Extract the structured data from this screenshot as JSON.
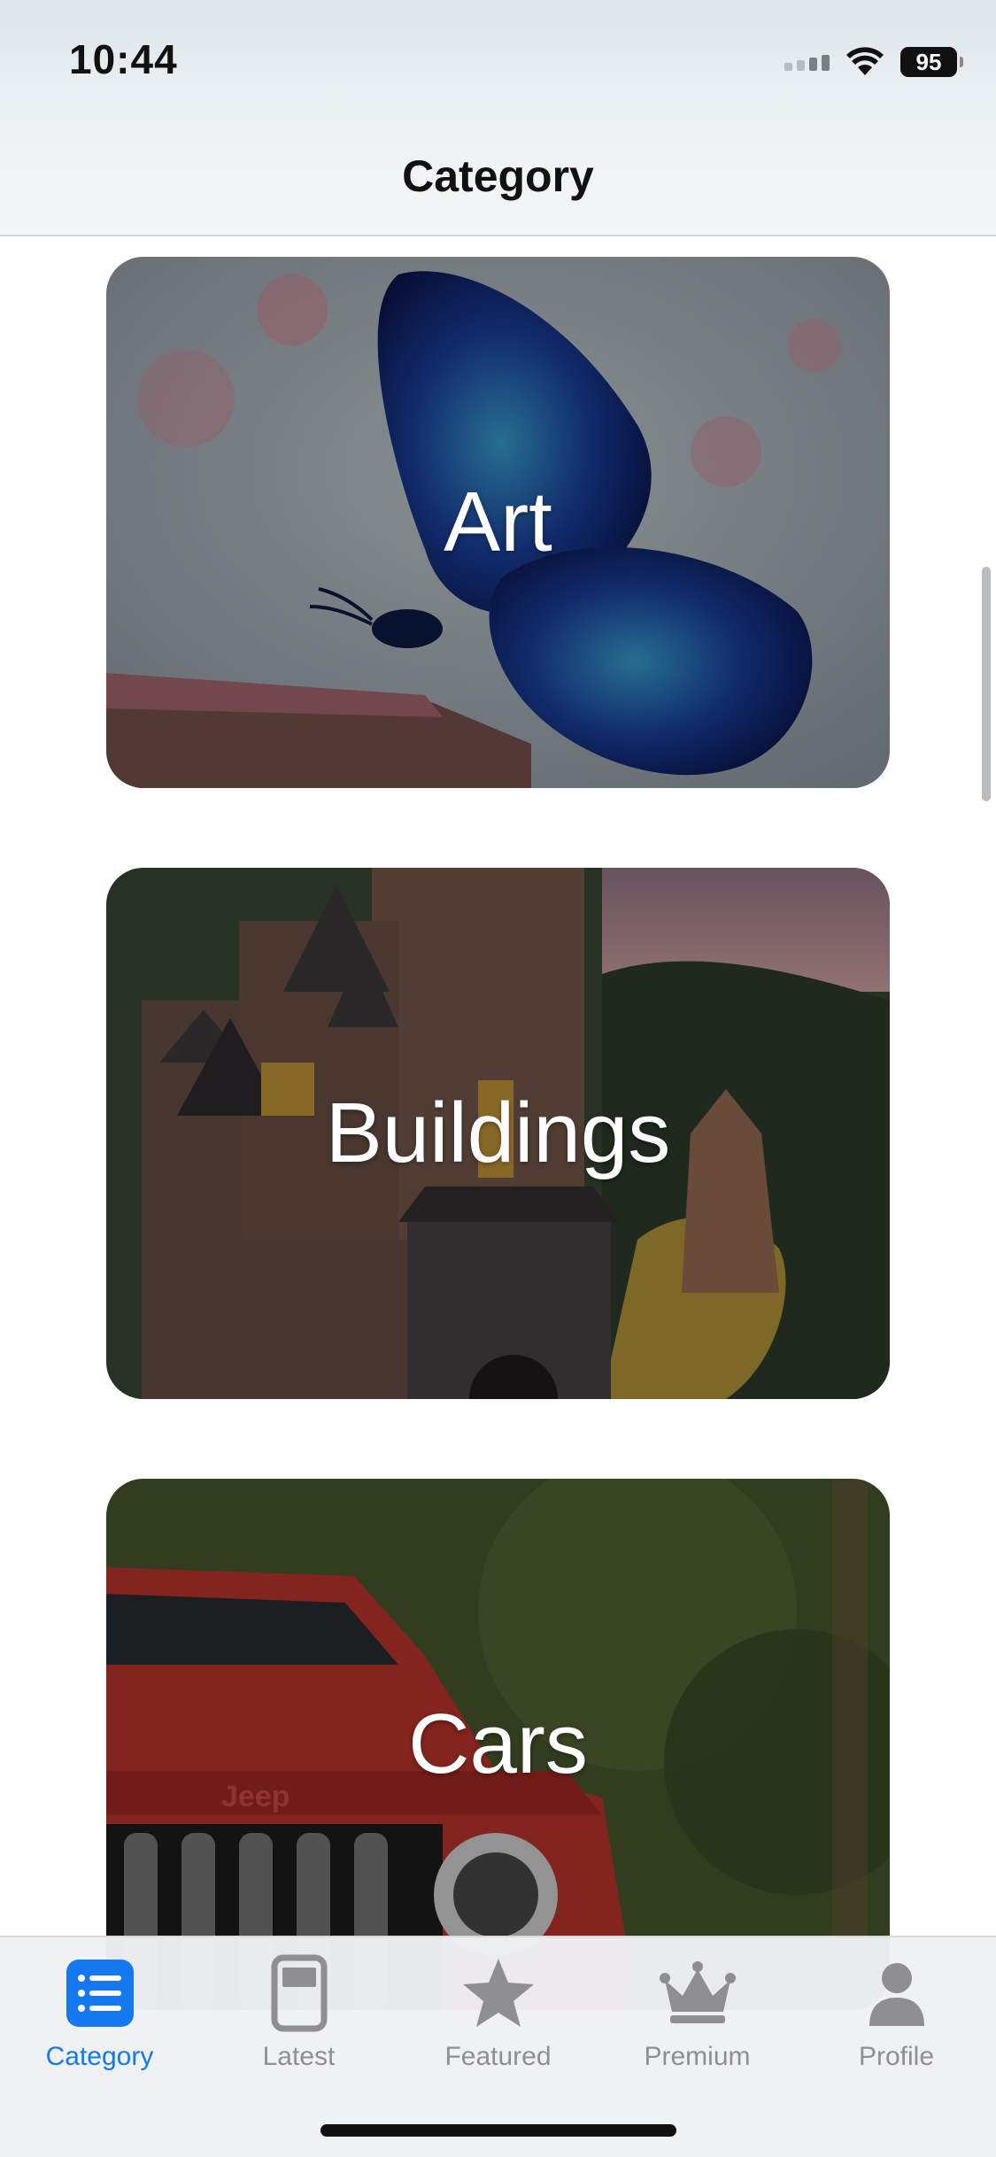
{
  "status_bar": {
    "time": "10:44",
    "battery": "95",
    "icons": [
      "cellular-signal-icon",
      "wifi-icon",
      "battery-icon"
    ]
  },
  "header": {
    "title": "Category"
  },
  "categories": [
    {
      "label": "Art",
      "image": "butterfly-on-book"
    },
    {
      "label": "Buildings",
      "image": "castle-in-forest"
    },
    {
      "label": "Cars",
      "image": "red-jeep"
    }
  ],
  "tab_bar": {
    "active": "Category",
    "tabs": [
      {
        "label": "Category",
        "icon": "list-icon"
      },
      {
        "label": "Latest",
        "icon": "tablet-icon"
      },
      {
        "label": "Featured",
        "icon": "star-icon"
      },
      {
        "label": "Premium",
        "icon": "crown-icon"
      },
      {
        "label": "Profile",
        "icon": "person-icon"
      }
    ]
  },
  "colors": {
    "accent": "#1479f0",
    "inactive_tab": "#8e8e93"
  }
}
